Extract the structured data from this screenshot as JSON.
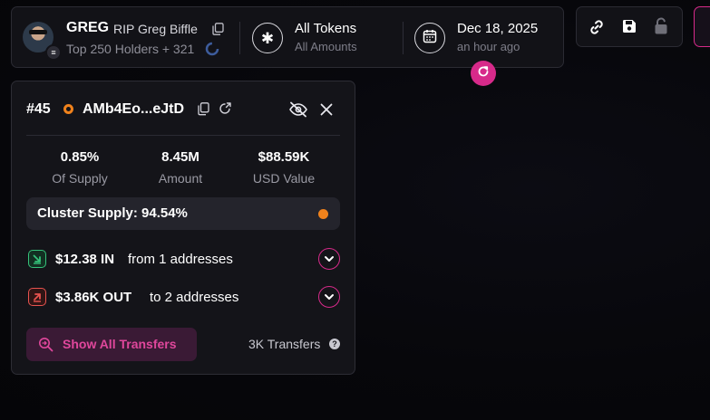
{
  "header": {
    "token_symbol": "GREG",
    "token_description": "RIP Greg Biffle",
    "holders_text": "Top 250 Holders + 321",
    "tokens_filter": {
      "title": "All Tokens",
      "subtitle": "All Amounts"
    },
    "date": {
      "title": "Dec 18, 2025",
      "subtitle": "an hour ago"
    }
  },
  "panel": {
    "rank": "#45",
    "address": "AMb4Eo...eJtD",
    "stats": [
      {
        "value": "0.85%",
        "label": "Of Supply"
      },
      {
        "value": "8.45M",
        "label": "Amount"
      },
      {
        "value": "$88.59K",
        "label": "USD Value"
      }
    ],
    "cluster_supply": "Cluster Supply: 94.54%",
    "flows": [
      {
        "amount": "$12.38 IN",
        "description": "from 1 addresses"
      },
      {
        "amount": "$3.86K OUT",
        "description": "to 2 addresses"
      }
    ],
    "show_transfers_label": "Show All Transfers",
    "transfers_count": "3K Transfers"
  },
  "colors": {
    "accent": "#d72a8a",
    "wallet_orange": "#f0821c",
    "in_green": "#35c27a",
    "out_red": "#e8534f"
  },
  "icons": [
    "copy-icon",
    "spinner-icon",
    "asterisk-icon",
    "calendar-icon",
    "refresh-icon",
    "link-icon",
    "save-icon",
    "lock-icon",
    "eye-off-icon",
    "close-icon",
    "arrow-in-icon",
    "arrow-out-icon",
    "chevron-down-icon",
    "search-transfers-icon",
    "help-icon"
  ]
}
